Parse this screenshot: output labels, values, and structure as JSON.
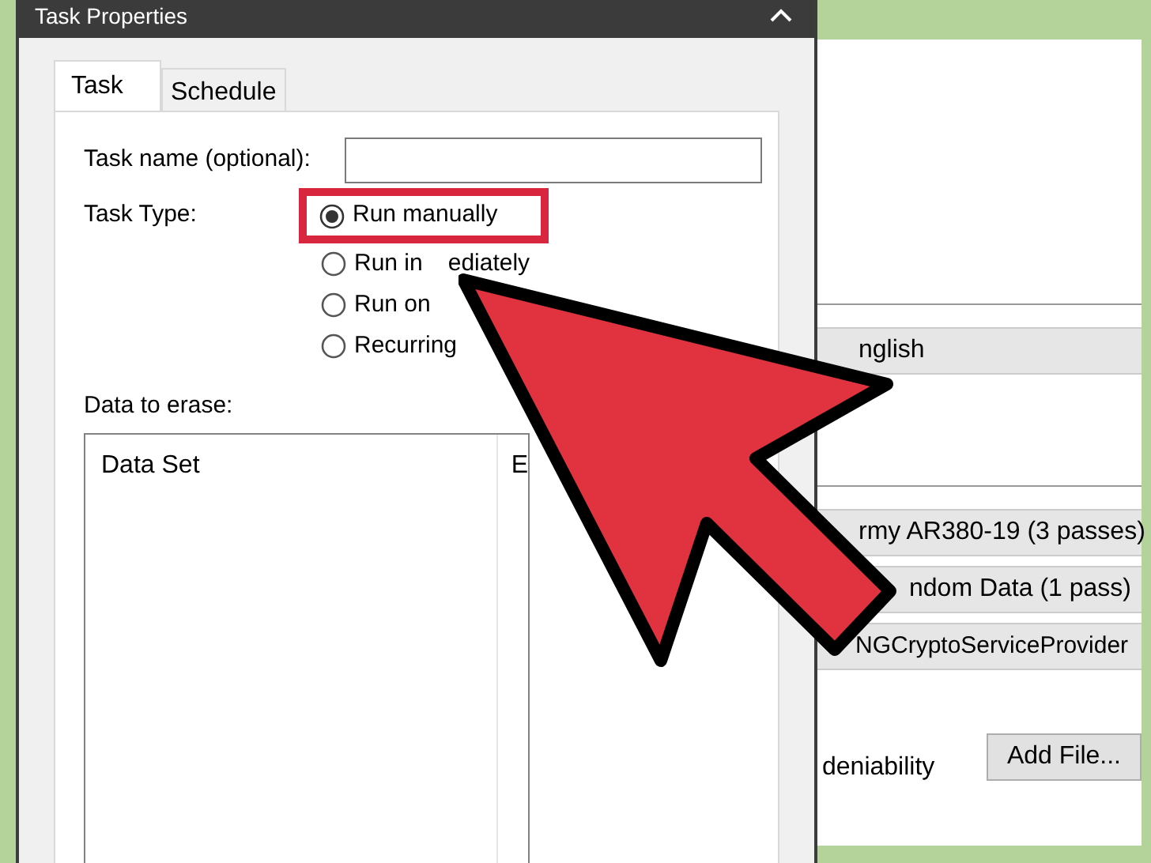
{
  "dialog": {
    "title": "Task Properties",
    "tabs": [
      {
        "label": "Task",
        "selected": true
      },
      {
        "label": "Schedule",
        "selected": false
      }
    ],
    "task_name": {
      "label": "Task name (optional):"
    },
    "task_type": {
      "label": "Task Type:",
      "options": [
        {
          "label": "Run manually",
          "selected": true,
          "highlighted": true
        },
        {
          "label": "Run in",
          "tail": "ediately",
          "selected": false,
          "highlighted": false
        },
        {
          "label": "Run on",
          "selected": false,
          "highlighted": false
        },
        {
          "label": "Recurring",
          "selected": false,
          "highlighted": false
        }
      ]
    },
    "data_to_erase": {
      "label": "Data to erase:",
      "columns": [
        "Data Set",
        "E"
      ]
    }
  },
  "background_window": {
    "rows": [
      {
        "kind": "bar",
        "text": "nglish"
      },
      {
        "kind": "blank"
      },
      {
        "kind": "bar",
        "text": "rmy AR380-19 (3 passes)"
      },
      {
        "kind": "bar",
        "text": "ndom Data (1 pass)"
      },
      {
        "kind": "bar",
        "text": "NGCryptoServiceProvider"
      }
    ],
    "label": "deniability",
    "button": "Add File..."
  }
}
